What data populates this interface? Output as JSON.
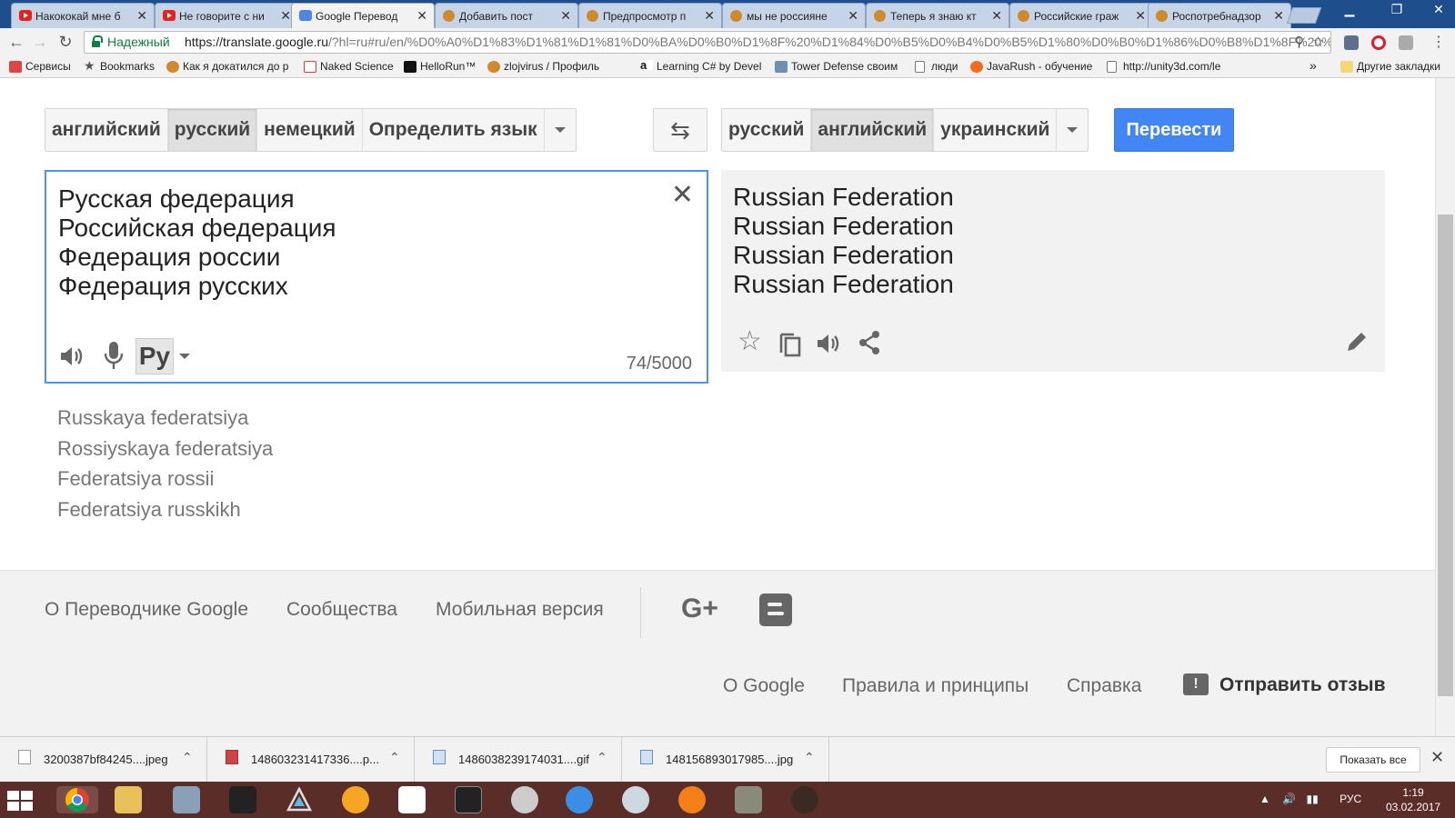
{
  "browser": {
    "tabs": [
      {
        "title": "Накококай мне б",
        "favicon": "youtube-icon"
      },
      {
        "title": "Не говорите с ни",
        "favicon": "youtube-icon"
      },
      {
        "title": "Google Перевод",
        "favicon": "google-translate-icon"
      },
      {
        "title": "Добавить пост",
        "favicon": "pikabu-icon"
      },
      {
        "title": "Предпросмотр п",
        "favicon": "pikabu-icon"
      },
      {
        "title": "мы не россияне",
        "favicon": "pikabu-icon"
      },
      {
        "title": "Теперь я знаю кт",
        "favicon": "pikabu-icon"
      },
      {
        "title": "Российские граж",
        "favicon": "pikabu-icon"
      },
      {
        "title": "Роспотребнадзор",
        "favicon": "pikabu-icon"
      }
    ],
    "active_tab": 2,
    "address": {
      "secure_label": "Надежный",
      "url_host": "https://translate.google.ru",
      "url_rest": "/?hl=ru#ru/en/%D0%A0%D1%83%D1%81%D1%81%D0%BA%D0%B0%D1%8F%20%D1%84%D0%B5%D0%B4%D0%B5%D1%80%D0%B0%D1%86%D0%B8%D1%8F%20%"
    },
    "bookmarks": [
      {
        "label": "Сервисы",
        "icon": "apps-grid-icon"
      },
      {
        "label": "Bookmarks",
        "icon": "star-icon"
      },
      {
        "label": "Как я докатился до р",
        "icon": "pikabu-icon"
      },
      {
        "label": "Naked Science",
        "icon": "naked-science-icon"
      },
      {
        "label": "HelloRun™",
        "icon": "hellorun-icon"
      },
      {
        "label": "zlojvirus / Профиль",
        "icon": "pikabu-icon"
      },
      {
        "label": "",
        "icon": "page-icon"
      },
      {
        "label": "Learning C# by Devel",
        "icon": "amazon-icon"
      },
      {
        "label": "Tower Defense своим",
        "icon": "habr-icon"
      },
      {
        "label": "люди",
        "icon": "page-icon"
      },
      {
        "label": "JavaRush - обучение",
        "icon": "javarush-icon"
      },
      {
        "label": "http://unity3d.com/le",
        "icon": "page-icon"
      }
    ],
    "bookmarks_more": "»",
    "other_bookmarks": "Другие закладки"
  },
  "translate": {
    "source_langs": [
      "английский",
      "русский",
      "немецкий",
      "Определить язык"
    ],
    "source_selected": 1,
    "target_langs": [
      "русский",
      "английский",
      "украинский"
    ],
    "target_selected": 1,
    "translate_button": "Перевести",
    "source_lines": [
      "Русская федерация",
      "Российская федерация",
      "Федерация россии",
      "Федерация русских"
    ],
    "target_lines": [
      "Russian Federation",
      "Russian Federation",
      "Russian Federation",
      "Russian Federation"
    ],
    "ime_label": "Ру",
    "char_count": "74/5000",
    "transliteration": [
      "Russkaya federatsiya",
      "Rossiyskaya federatsiya",
      "Federatsiya rossii",
      "Federatsiya russkikh"
    ]
  },
  "footer": {
    "links_top": [
      "О Переводчике Google",
      "Сообщества",
      "Мобильная версия"
    ],
    "gplus": "G+",
    "links_bottom": [
      "О Google",
      "Правила и принципы",
      "Справка"
    ],
    "feedback": "Отправить отзыв",
    "feedback_icon": "!"
  },
  "downloads": {
    "items": [
      {
        "name": "3200387bf84245....jpeg",
        "icon": "file-icon"
      },
      {
        "name": "148603231417336....p...",
        "icon": "image-file-icon"
      },
      {
        "name": "1486038239174031....gif",
        "icon": "image-file-icon"
      },
      {
        "name": "148156893017985....jpg",
        "icon": "image-file-icon"
      }
    ],
    "show_all": "Показать все"
  },
  "taskbar": {
    "language": "РУС",
    "time": "1:19",
    "date": "03.02.2017"
  },
  "colors": {
    "accent": "#4285f4",
    "tabstrip": "#1f4e8c",
    "taskbar": "#5a2d28"
  }
}
